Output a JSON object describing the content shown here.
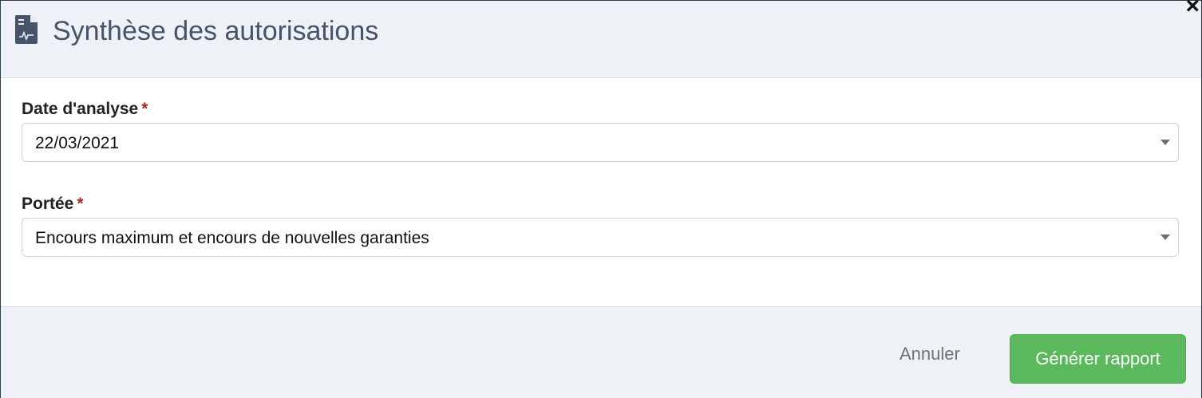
{
  "dialog": {
    "title": "Synthèse des autorisations",
    "icon": "document-chart-icon",
    "close_label": "×"
  },
  "form": {
    "date": {
      "label": "Date d'analyse",
      "required_mark": "*",
      "value": "22/03/2021"
    },
    "portee": {
      "label": "Portée",
      "required_mark": "*",
      "value": "Encours maximum et encours de nouvelles garanties"
    }
  },
  "footer": {
    "cancel_label": "Annuler",
    "submit_label": "Générer rapport"
  },
  "colors": {
    "header_bg": "#eef1f6",
    "required": "#a02c1f",
    "primary_button": "#5cb85c"
  }
}
